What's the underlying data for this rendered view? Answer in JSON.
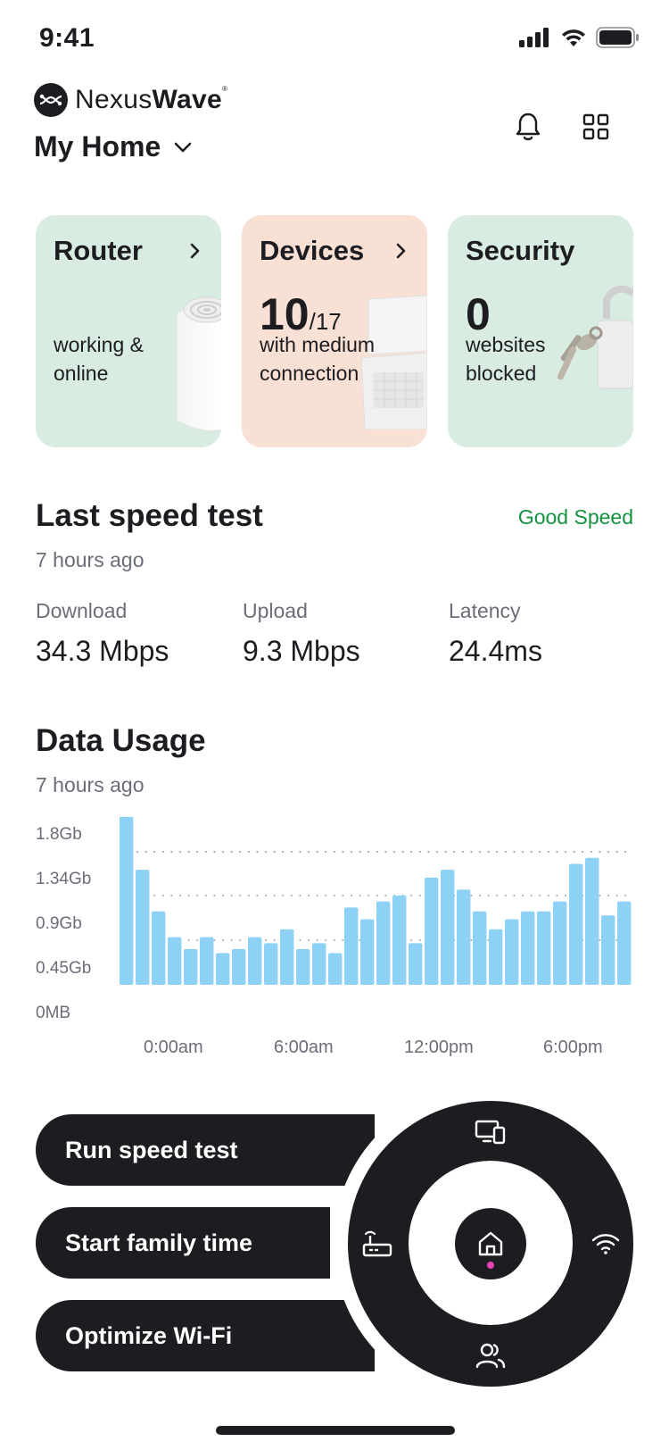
{
  "status_bar": {
    "time": "9:41"
  },
  "brand": {
    "name_light": "Nexus",
    "name_bold": "Wave",
    "mark": "®"
  },
  "header": {
    "home_name": "My Home"
  },
  "cards": {
    "router": {
      "title": "Router",
      "line1": "working &",
      "line2": "online",
      "color": "#d9ece1"
    },
    "devices": {
      "title": "Devices",
      "count": "10",
      "total": "/17",
      "line1": "with medium",
      "line2": "connection",
      "color": "#f9e0d5"
    },
    "security": {
      "title": "Security",
      "count": "0",
      "line1": "websites",
      "line2": "blocked",
      "color": "#d9ece1"
    }
  },
  "speed_test": {
    "title": "Last speed test",
    "when": "7 hours ago",
    "status": "Good Speed",
    "status_color": "#14923f",
    "download_label": "Download",
    "download_value": "34.3 Mbps",
    "upload_label": "Upload",
    "upload_value": "9.3 Mbps",
    "latency_label": "Latency",
    "latency_value": "24.4ms"
  },
  "data_usage": {
    "title": "Data Usage",
    "when": "7 hours ago"
  },
  "chart_data": {
    "type": "bar",
    "title": "",
    "xlabel": "",
    "ylabel": "",
    "y_ticks": [
      "0MB",
      "0.45Gb",
      "0.9Gb",
      "1.34Gb",
      "1.8Gb"
    ],
    "x_ticks": [
      "0:00am",
      "6:00am",
      "12:00pm",
      "6:00pm"
    ],
    "ylim": [
      0,
      1.8
    ],
    "bar_color": "#8dd1f4",
    "grid": "dotted",
    "values": [
      1.8,
      1.16,
      0.74,
      0.48,
      0.36,
      0.48,
      0.32,
      0.36,
      0.48,
      0.42,
      0.56,
      0.36,
      0.42,
      0.32,
      0.78,
      0.66,
      0.84,
      0.9,
      0.42,
      1.08,
      1.16,
      0.96,
      0.74,
      0.56,
      0.66,
      0.74,
      0.74,
      0.84,
      1.22,
      1.28,
      0.7,
      0.84
    ]
  },
  "actions": {
    "run_speed_test": "Run speed test",
    "start_family_time": "Start family time",
    "optimize_wifi": "Optimize Wi-Fi"
  },
  "nav_ring": {
    "top": "devices-icon",
    "left": "router-icon",
    "right": "wifi-icon",
    "bottom": "people-icon",
    "center": "home-icon",
    "accent_dot_color": "#e840b4"
  }
}
